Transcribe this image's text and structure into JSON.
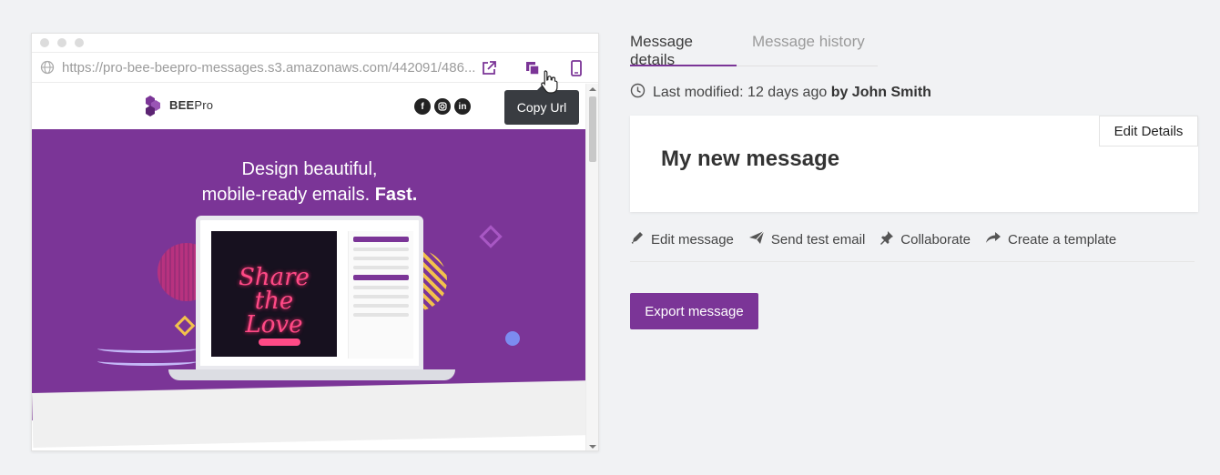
{
  "preview": {
    "url": "https://pro-bee-beepro-messages.s3.amazonaws.com/442091/486...",
    "tooltip": "Copy Url",
    "email": {
      "logo_bold": "BEE",
      "logo_light": "Pro",
      "headline_line1": "Design beautiful,",
      "headline_line2_regular": "mobile-ready emails.",
      "headline_line2_bold": "Fast.",
      "social_icons": [
        "facebook-icon",
        "instagram-icon",
        "linkedin-icon"
      ],
      "neon_text": "Share the Love"
    }
  },
  "tabs": [
    {
      "label": "Message details",
      "active": true
    },
    {
      "label": "Message history",
      "active": false
    }
  ],
  "modified": {
    "prefix": "Last modified: 12 days ago",
    "by_label": "by John Smith"
  },
  "card": {
    "title": "My new message",
    "edit_details_label": "Edit Details"
  },
  "actions": [
    {
      "label": "Edit message",
      "icon": "pencil-icon"
    },
    {
      "label": "Send test email",
      "icon": "paper-plane-icon"
    },
    {
      "label": "Collaborate",
      "icon": "pin-icon"
    },
    {
      "label": "Create a template",
      "icon": "share-arrow-icon"
    }
  ],
  "export_label": "Export message",
  "colors": {
    "accent": "#7b3597",
    "background": "#f1f2f4",
    "tooltip_bg": "#393c41"
  }
}
